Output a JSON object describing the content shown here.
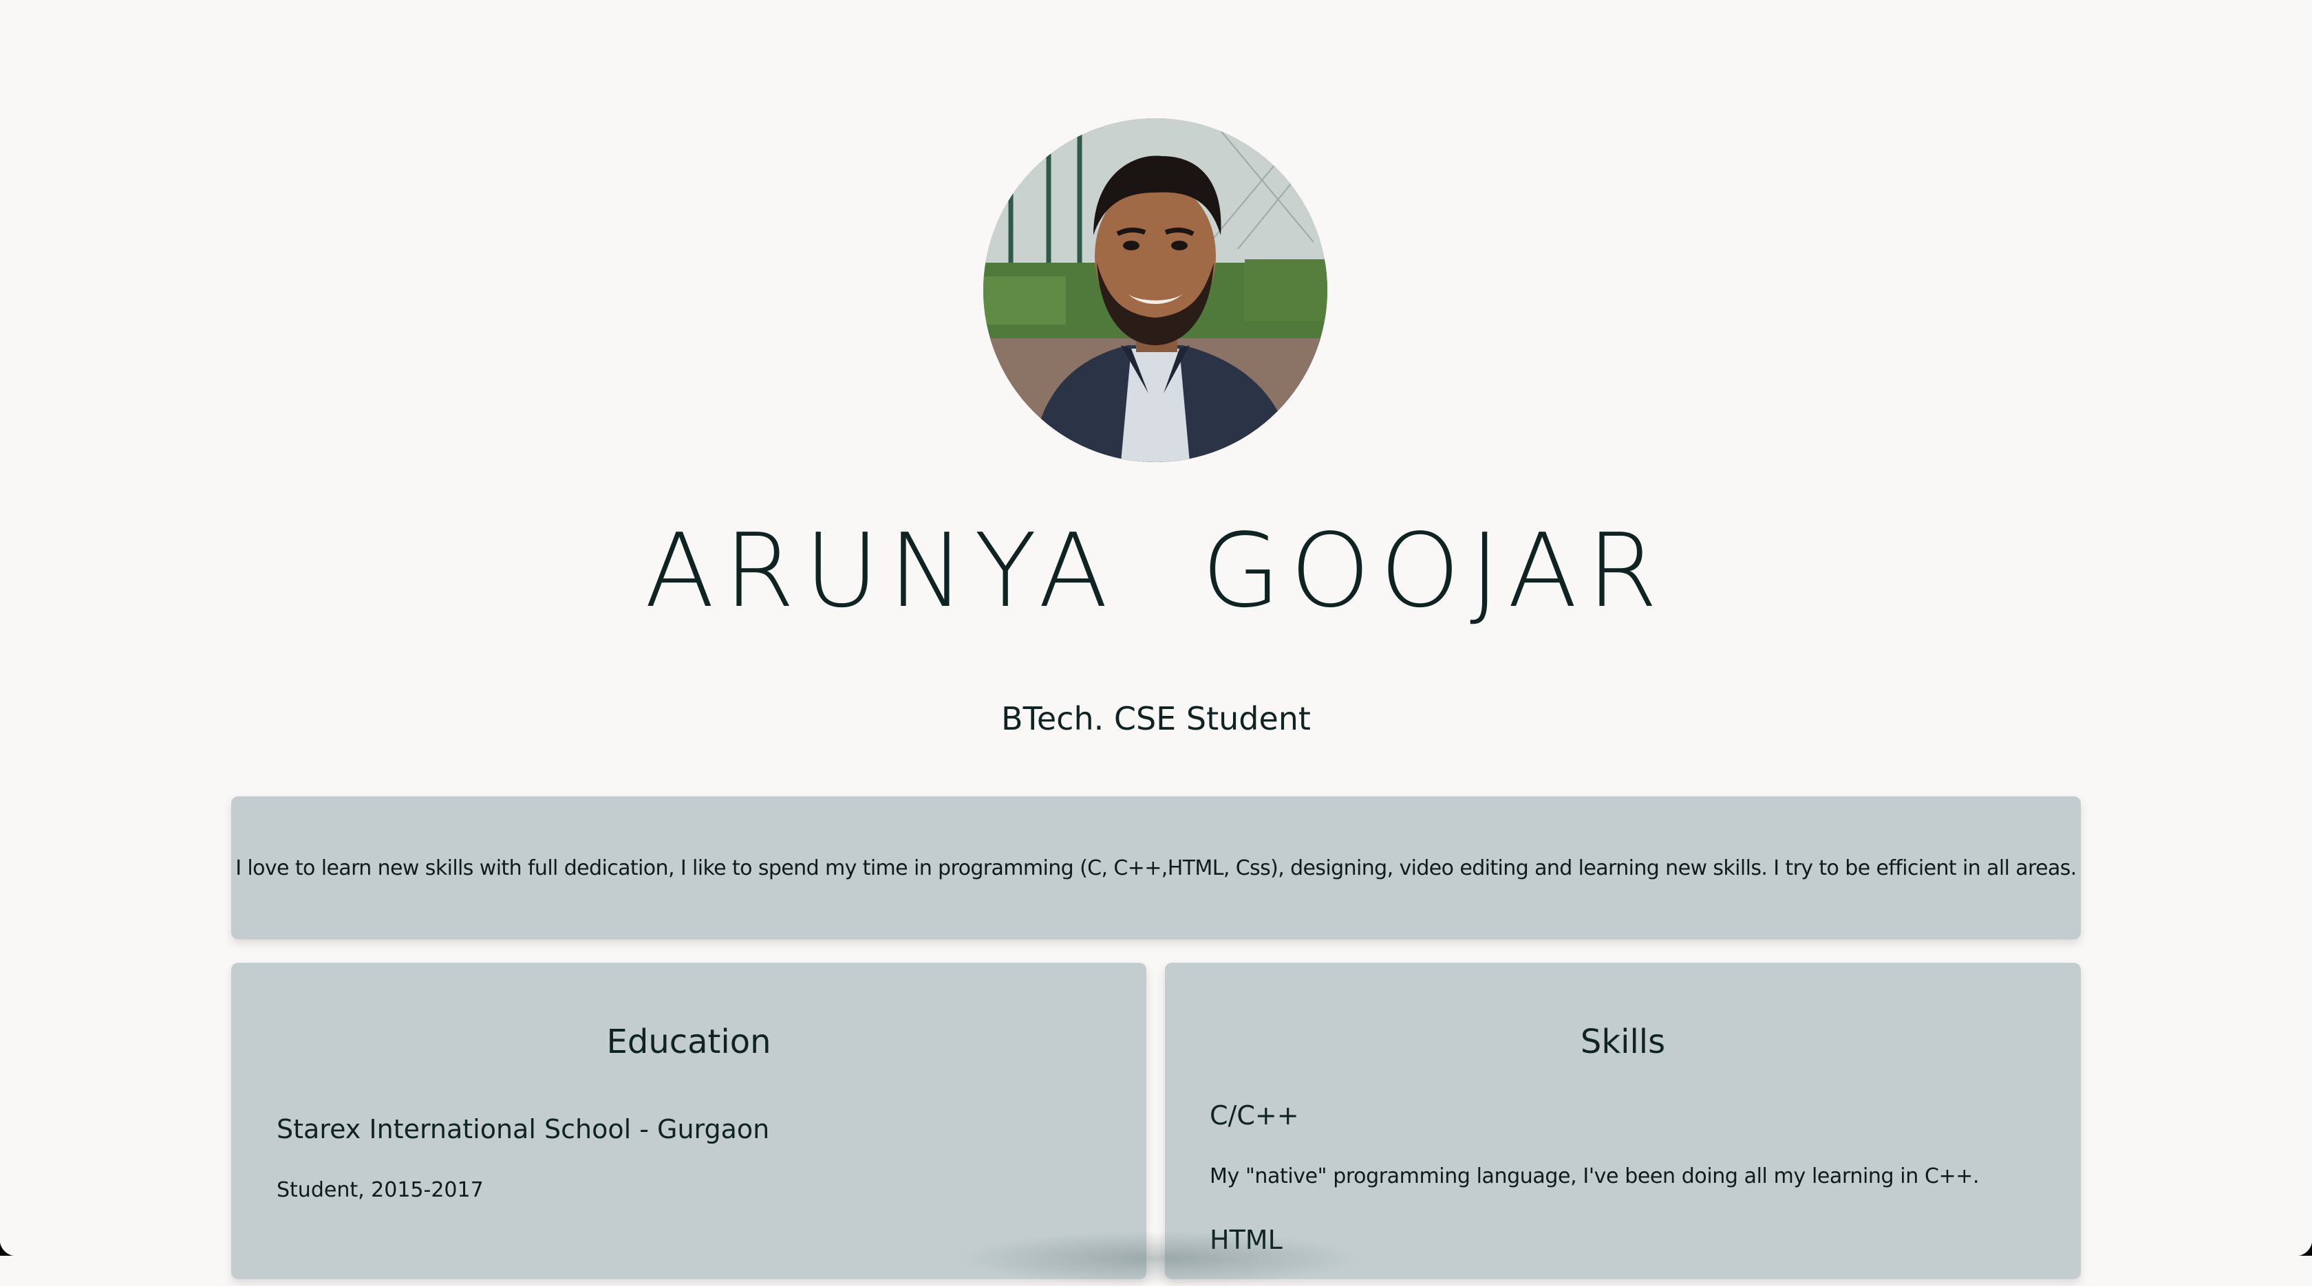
{
  "profile": {
    "name": "ARUNYA  GOOJAR",
    "subtitle": "BTech. CSE Student",
    "photo_description": "profile-photo"
  },
  "bio": {
    "text": "I love to learn new skills with full dedication, I like to spend my time in programming (C, C++,HTML, Css), designing, video editing and learning new skills. I try to be efficient in all areas."
  },
  "education": {
    "title": "Education",
    "school": "Starex International School - Gurgaon",
    "role": "Student, 2015-2017"
  },
  "skills": {
    "title": "Skills",
    "items": [
      {
        "name": "C/C++",
        "description": "My \"native\" programming language, I've been doing all my learning in C++."
      },
      {
        "name": "HTML",
        "description": ""
      }
    ]
  },
  "colors": {
    "background": "#faf8f7",
    "card": "#c3cdcf",
    "text": "#0f2422"
  }
}
